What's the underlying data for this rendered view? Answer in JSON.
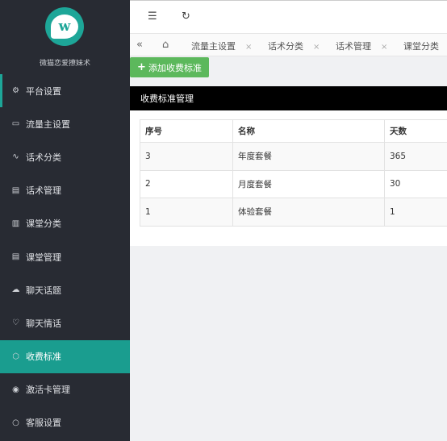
{
  "sidebar": {
    "logo_letter": "w",
    "brand": "微猫恋爱撩妹术",
    "items": [
      {
        "label": "平台设置",
        "icon": "gear-icon",
        "glyph": "⚙"
      },
      {
        "label": "流量主设置",
        "icon": "video-icon",
        "glyph": "▭"
      },
      {
        "label": "话术分类",
        "icon": "pulse-icon",
        "glyph": "∿"
      },
      {
        "label": "话术管理",
        "icon": "document-icon",
        "glyph": "▤"
      },
      {
        "label": "课堂分类",
        "icon": "book-icon",
        "glyph": "▥"
      },
      {
        "label": "课堂管理",
        "icon": "file-icon",
        "glyph": "▤"
      },
      {
        "label": "聊天话题",
        "icon": "chat-icon",
        "glyph": "☁"
      },
      {
        "label": "聊天情话",
        "icon": "heart-icon",
        "glyph": "♡"
      },
      {
        "label": "收费标准",
        "icon": "cube-icon",
        "glyph": "⬡"
      },
      {
        "label": "激活卡管理",
        "icon": "circle-icon",
        "glyph": "◉"
      },
      {
        "label": "客服设置",
        "icon": "support-icon",
        "glyph": "○"
      }
    ]
  },
  "topbar": {
    "menu_glyph": "☰",
    "refresh_glyph": "↻"
  },
  "tabs": {
    "back_glyph": "«",
    "home_glyph": "⌂",
    "close_glyph": "×",
    "items": [
      "流量主设置",
      "话术分类",
      "话术管理",
      "课堂分类"
    ]
  },
  "add_button": {
    "label": "添加收费标准",
    "plus": "+"
  },
  "panel": {
    "title": "收费标准管理",
    "columns": [
      "序号",
      "名称",
      "天数"
    ],
    "rows": [
      [
        "3",
        "年度套餐",
        "365"
      ],
      [
        "2",
        "月度套餐",
        "30"
      ],
      [
        "1",
        "体验套餐",
        "1"
      ]
    ]
  },
  "colors": {
    "sidebar_bg": "#282b33",
    "accent": "#1a9d8f",
    "add_button": "#5cb85c"
  }
}
